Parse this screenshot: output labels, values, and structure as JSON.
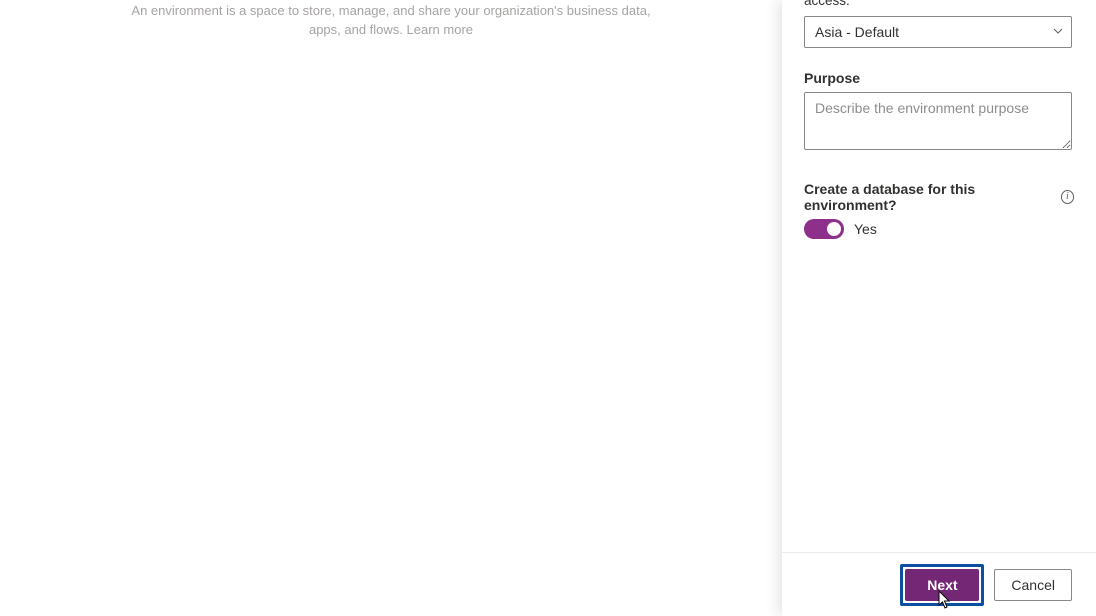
{
  "main": {
    "description_line1": "An environment is a space to store, manage, and share your organization's business data,",
    "description_line2_prefix": "apps, and flows. ",
    "learn_more": "Learn more"
  },
  "panel": {
    "region_help_fragment": "access.",
    "region_select_value": "Asia - Default",
    "purpose_label": "Purpose",
    "purpose_placeholder": "Describe the environment purpose",
    "purpose_value": "",
    "create_db_label": "Create a database for this environment?",
    "toggle_state": "Yes"
  },
  "footer": {
    "next_label": "Next",
    "cancel_label": "Cancel"
  },
  "colors": {
    "accent": "#742774",
    "toggle": "#8d2f8b",
    "highlight_border": "#0b4fa0"
  }
}
